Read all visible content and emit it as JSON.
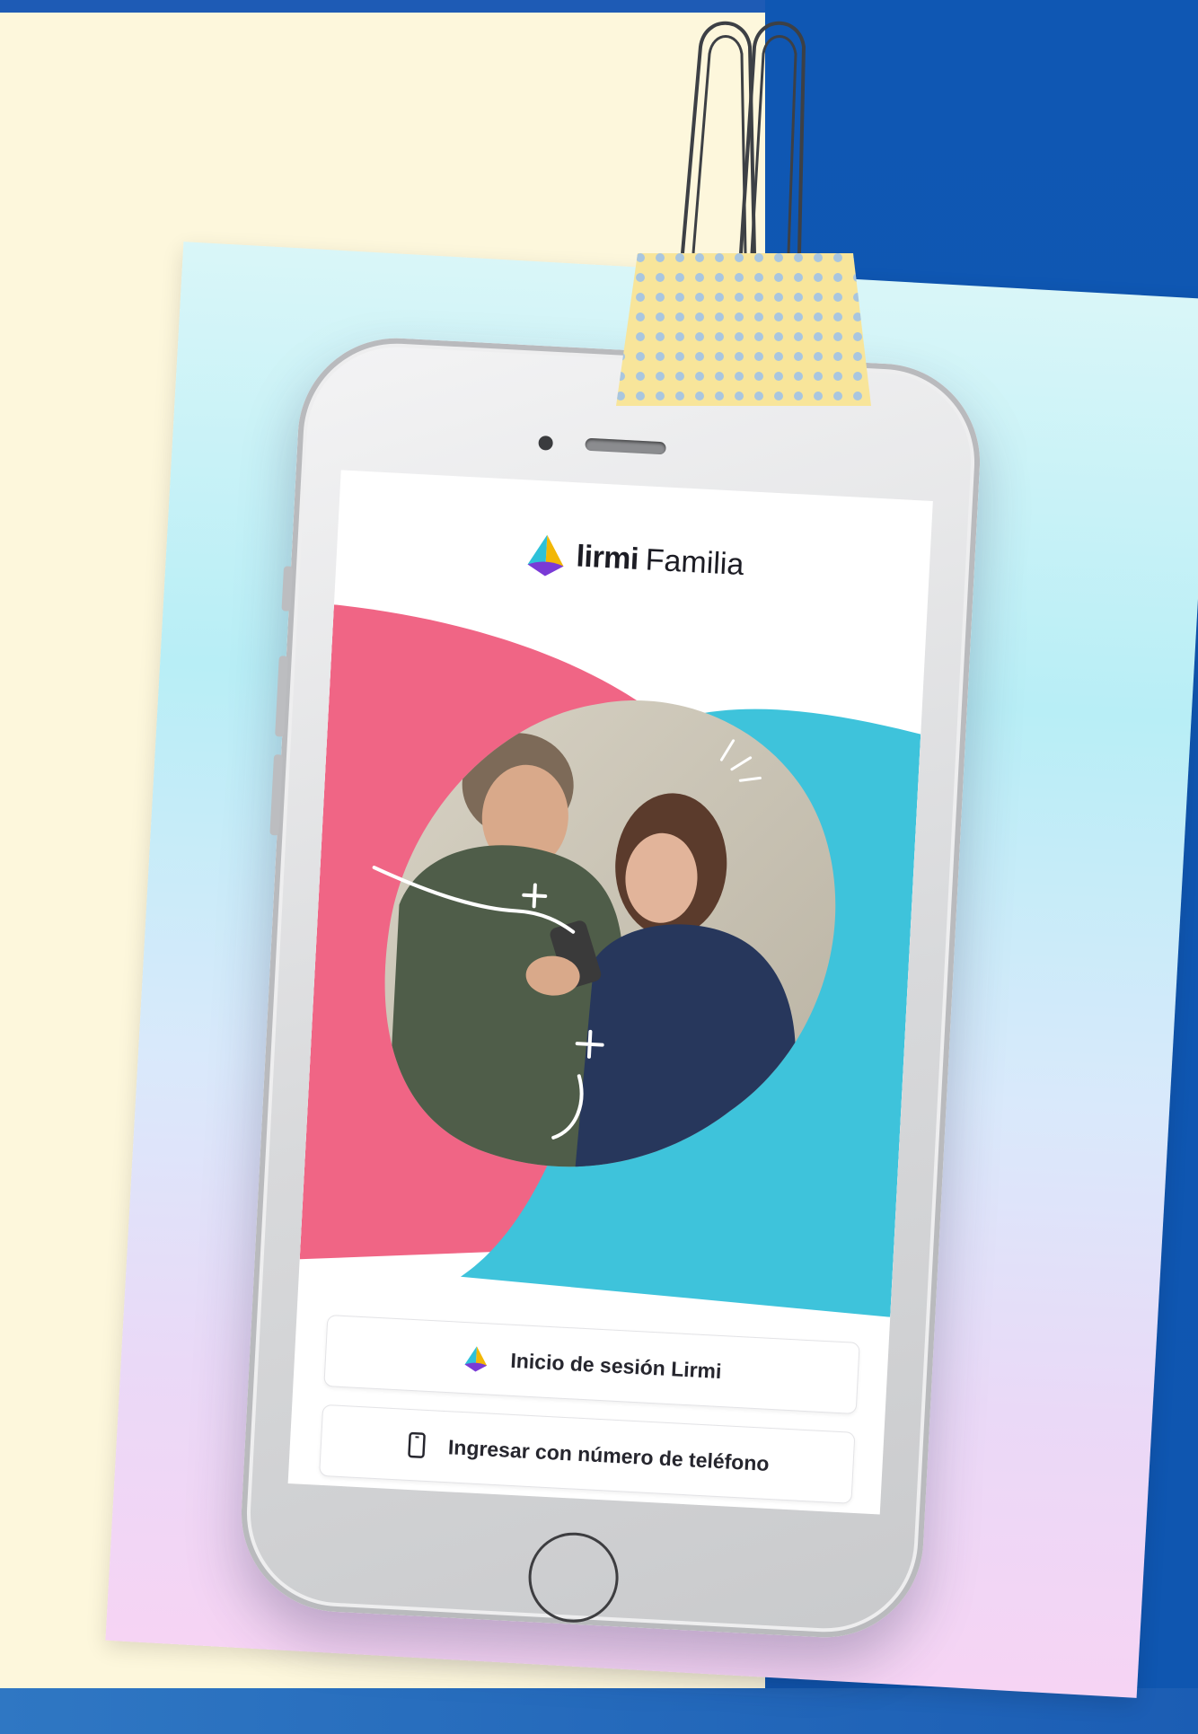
{
  "app": {
    "logo_bold": "lirmi",
    "logo_regular": "Familia",
    "logo_icon": "lirmi-logo-icon"
  },
  "buttons": {
    "lirmi_login": {
      "label": "Inicio de sesión Lirmi",
      "icon": "lirmi-logo-icon"
    },
    "phone_login": {
      "label": "Ingresar con número de teléfono",
      "icon": "phone-icon"
    }
  },
  "colors": {
    "brand_pink": "#f06585",
    "brand_cyan": "#3ec3db",
    "background_blue": "#0f56b0",
    "background_cream": "#fdf7dc",
    "clip_yellow": "#f8e59a"
  }
}
